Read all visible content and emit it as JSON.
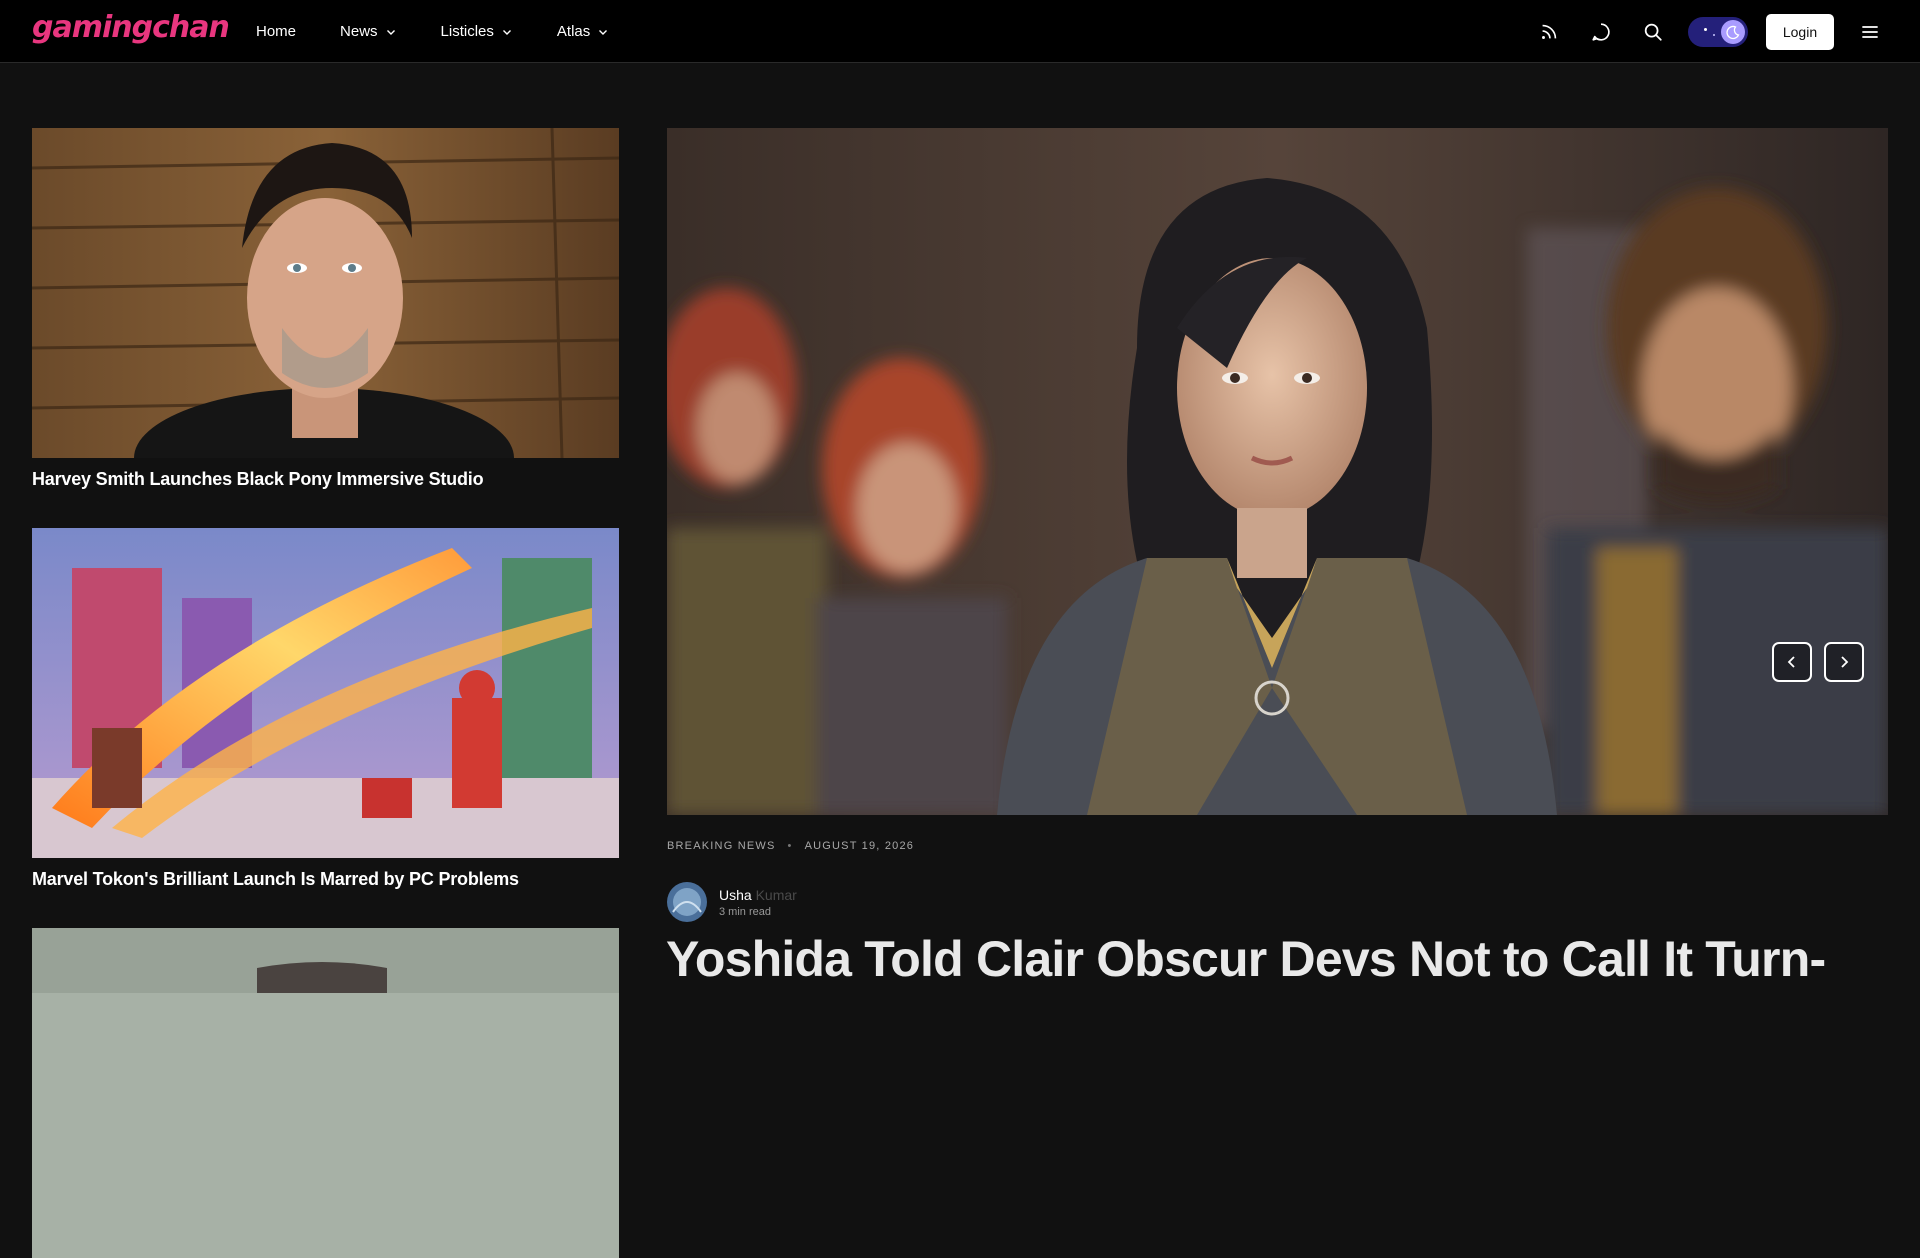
{
  "brand": {
    "logo_text": "gamingchan",
    "accent_color": "#e8367f"
  },
  "nav": {
    "items": [
      {
        "label": "Home",
        "has_dropdown": false
      },
      {
        "label": "News",
        "has_dropdown": true
      },
      {
        "label": "Listicles",
        "has_dropdown": true
      },
      {
        "label": "Atlas",
        "has_dropdown": true
      }
    ]
  },
  "header_actions": {
    "icons": [
      "rss-icon",
      "chat-icon",
      "search-icon"
    ],
    "theme_toggle": "dark",
    "login_label": "Login",
    "menu_icon": "hamburger-menu-icon"
  },
  "sidebar_cards": [
    {
      "title": "Harvey Smith Launches Black Pony Immersive Studio"
    },
    {
      "title": "Marvel Tokon's Brilliant Launch Is Marred by PC Problems"
    },
    {
      "title": ""
    }
  ],
  "hero": {
    "category": "BREAKING NEWS",
    "date": "AUGUST 19, 2026",
    "author_first": "Usha",
    "author_last": "Kumar",
    "read_time": "3 min read",
    "title": "Yoshida Told Clair Obscur Devs Not to Call It Turn-",
    "prev_icon": "chevron-left-icon",
    "next_icon": "chevron-right-icon"
  }
}
